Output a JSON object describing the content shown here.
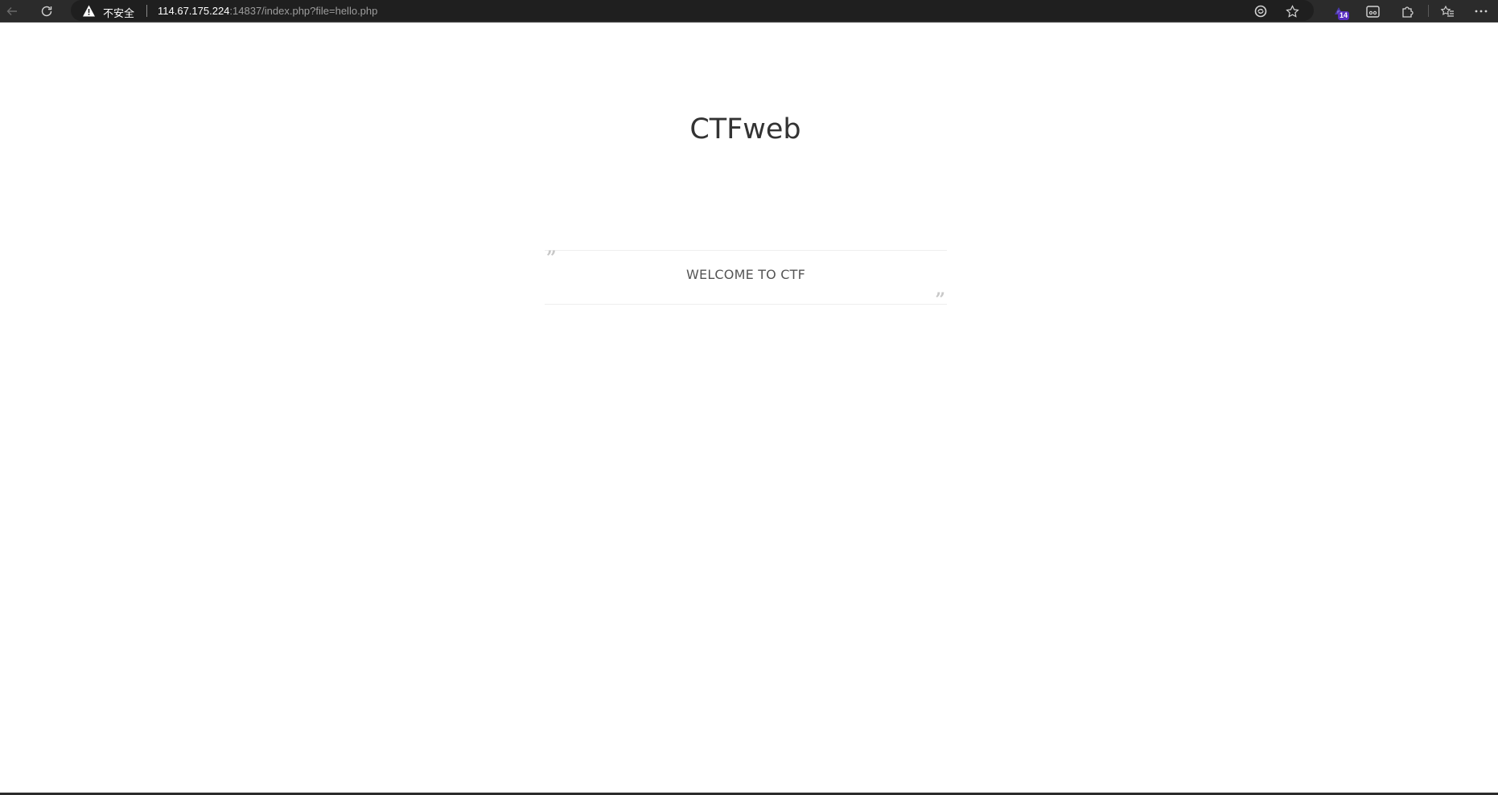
{
  "browser": {
    "address": {
      "security_label": "不安全",
      "url_host": "114.67.175.224",
      "url_rest": ":14837/index.php?file=hello.php"
    },
    "icons": {
      "back": "back-arrow-icon",
      "reload": "reload-icon",
      "warning": "warning-triangle-icon",
      "refresh_shield": "browser-essentials-icon",
      "favorite": "star-icon",
      "extension": "extension-icon",
      "extension_badge": "14",
      "reader": "immersive-reader-icon",
      "puzzle": "extensions-puzzle-icon",
      "favorites_list": "favorites-icon",
      "menu": "more-menu-icon"
    }
  },
  "page": {
    "title": "CTFweb",
    "quote": "WELCOME TO CTF"
  },
  "colors": {
    "toolbar_bg": "#2b2b2b",
    "address_bg": "#1f1f1f",
    "title_text": "#333333",
    "quote_text": "#555555",
    "badge_bg": "#5a2fc2"
  }
}
